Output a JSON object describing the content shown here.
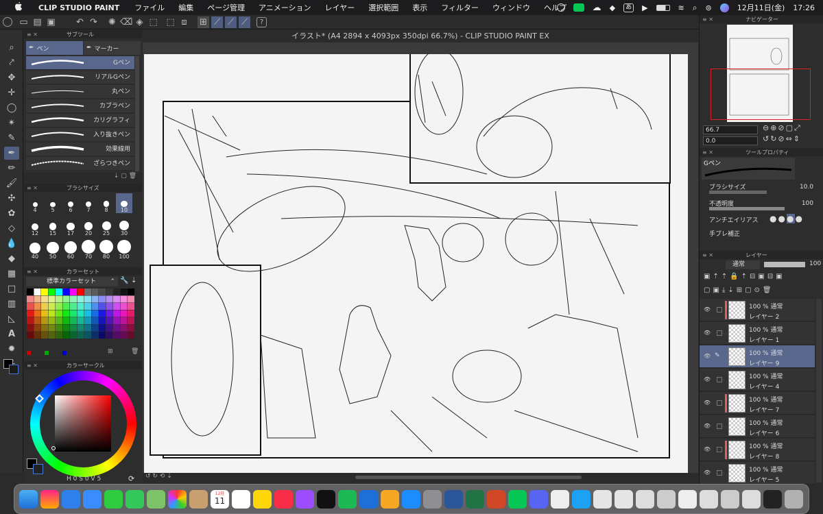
{
  "menubar": {
    "app": "CLIP STUDIO PAINT",
    "items": [
      "ファイル",
      "編集",
      "ページ管理",
      "アニメーション",
      "レイヤー",
      "選択範囲",
      "表示",
      "フィルター",
      "ウィンドウ",
      "ヘルプ"
    ],
    "date": "12月11日(金)",
    "time": "17:26",
    "ime": "あ"
  },
  "document": {
    "title": "イラスト* (A4 2894 x 4093px 350dpi 66.7%)  - CLIP STUDIO PAINT EX"
  },
  "subtool": {
    "title": "サブツール",
    "tabs": [
      "ペン",
      "マーカー"
    ],
    "brushes": [
      "Gペン",
      "リアルGペン",
      "丸ペン",
      "カブラペン",
      "カリグラフィ",
      "入り抜きペン",
      "効果線用",
      "ざらつきペン"
    ]
  },
  "brushsize": {
    "title": "ブラシサイズ",
    "sizes": [
      "4",
      "5",
      "6",
      "7",
      "8",
      "10",
      "12",
      "15",
      "17",
      "20",
      "25",
      "30",
      "40",
      "50",
      "60",
      "70",
      "80",
      "100"
    ]
  },
  "colorset": {
    "title": "カラーセット",
    "name": "標準カラーセット"
  },
  "colorwheel": {
    "title": "カラーサークル",
    "h": "0",
    "s": "0",
    "v": "5"
  },
  "navigator": {
    "title": "ナビゲーター",
    "zoom": "66.7",
    "angle": "0.0"
  },
  "toolprop": {
    "title": "ツールプロパティ",
    "brush": "Gペン",
    "size_label": "ブラシサイズ",
    "size": "10.0",
    "opacity_label": "不透明度",
    "opacity": "100",
    "aa_label": "アンチエイリアス",
    "stab_label": "手ブレ補正"
  },
  "layers": {
    "title": "レイヤー",
    "blend": "通常",
    "opacity": "100",
    "rows": [
      {
        "mode": "100 % 通常",
        "name": "レイヤー 2"
      },
      {
        "mode": "100 % 通常",
        "name": "レイヤー 1"
      },
      {
        "mode": "100 % 通常",
        "name": "レイヤー 9"
      },
      {
        "mode": "100 % 通常",
        "name": "レイヤー 4"
      },
      {
        "mode": "100 % 通常",
        "name": "レイヤー 7"
      },
      {
        "mode": "100 % 通常",
        "name": "レイヤー 6"
      },
      {
        "mode": "100 % 通常",
        "name": "レイヤー 8"
      },
      {
        "mode": "100 % 通常",
        "name": "レイヤー 5"
      }
    ]
  },
  "dock": {
    "calendar_month": "12月",
    "calendar_day": "11"
  }
}
